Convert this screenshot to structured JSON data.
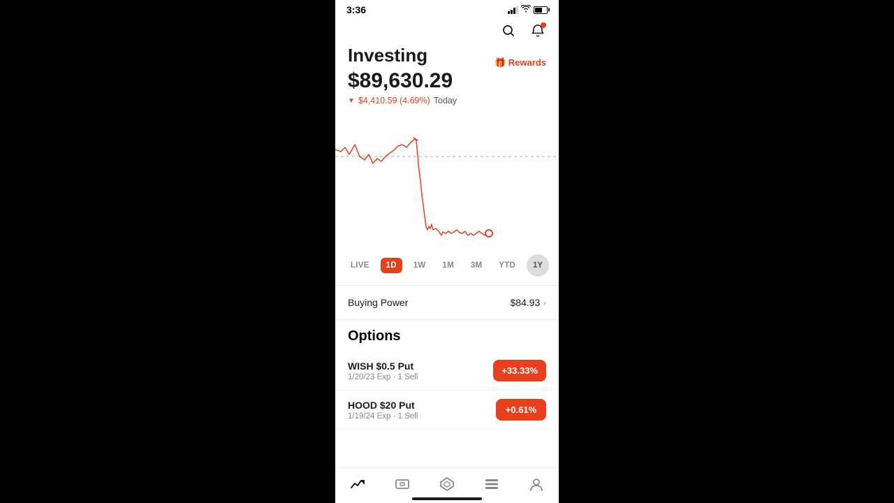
{
  "statusBar": {
    "time": "3:36",
    "battery": 60
  },
  "header": {
    "title": "Investing",
    "rewardsLabel": "🎁 Rewards"
  },
  "portfolio": {
    "value": "$89,630.29",
    "changeAmount": "$4,410.59",
    "changePercent": "(4.69%)",
    "changeLabel": "Today"
  },
  "timeTabs": [
    {
      "label": "LIVE",
      "id": "live",
      "active": false
    },
    {
      "label": "1D",
      "id": "1d",
      "active": true
    },
    {
      "label": "1W",
      "id": "1w",
      "active": false
    },
    {
      "label": "1M",
      "id": "1m",
      "active": false
    },
    {
      "label": "3M",
      "id": "3m",
      "active": false
    },
    {
      "label": "YTD",
      "id": "ytd",
      "active": false
    },
    {
      "label": "1Y",
      "id": "1y",
      "active": false,
      "circled": true
    }
  ],
  "buyingPower": {
    "label": "Buying Power",
    "value": "$84.93"
  },
  "options": {
    "sectionTitle": "Options",
    "items": [
      {
        "name": "WISH $0.5 Put",
        "sub": "1/20/23 Exp · 1 Sell",
        "badge": "+33.33%"
      },
      {
        "name": "HOOD $20 Put",
        "sub": "1/19/24 Exp · 1 Sell",
        "badge": "+0.61%"
      }
    ]
  },
  "bottomNav": [
    {
      "icon": "📈",
      "name": "investing",
      "active": true
    },
    {
      "icon": "💳",
      "name": "cash",
      "active": false
    },
    {
      "icon": "🔷",
      "name": "crypto",
      "active": false
    },
    {
      "icon": "📋",
      "name": "discover",
      "active": false
    },
    {
      "icon": "👤",
      "name": "account",
      "active": false
    }
  ]
}
